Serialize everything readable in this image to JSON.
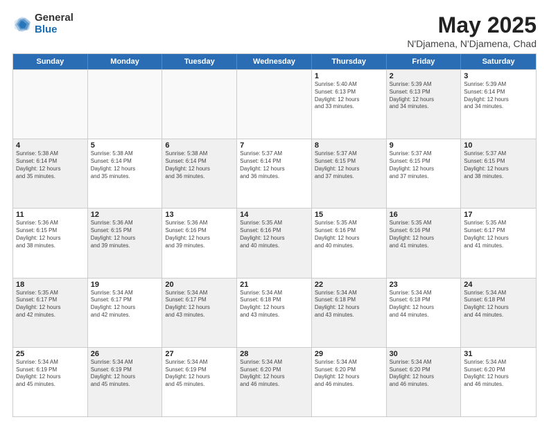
{
  "logo": {
    "general": "General",
    "blue": "Blue"
  },
  "title": "May 2025",
  "subtitle": "N'Djamena, N'Djamena, Chad",
  "header_days": [
    "Sunday",
    "Monday",
    "Tuesday",
    "Wednesday",
    "Thursday",
    "Friday",
    "Saturday"
  ],
  "rows": [
    [
      {
        "day": "",
        "detail": "",
        "empty": true
      },
      {
        "day": "",
        "detail": "",
        "empty": true
      },
      {
        "day": "",
        "detail": "",
        "empty": true
      },
      {
        "day": "",
        "detail": "",
        "empty": true
      },
      {
        "day": "1",
        "detail": "Sunrise: 5:40 AM\nSunset: 6:13 PM\nDaylight: 12 hours\nand 33 minutes.",
        "empty": false
      },
      {
        "day": "2",
        "detail": "Sunrise: 5:39 AM\nSunset: 6:13 PM\nDaylight: 12 hours\nand 34 minutes.",
        "empty": false,
        "shaded": true
      },
      {
        "day": "3",
        "detail": "Sunrise: 5:39 AM\nSunset: 6:14 PM\nDaylight: 12 hours\nand 34 minutes.",
        "empty": false
      }
    ],
    [
      {
        "day": "4",
        "detail": "Sunrise: 5:38 AM\nSunset: 6:14 PM\nDaylight: 12 hours\nand 35 minutes.",
        "empty": false,
        "shaded": true
      },
      {
        "day": "5",
        "detail": "Sunrise: 5:38 AM\nSunset: 6:14 PM\nDaylight: 12 hours\nand 35 minutes.",
        "empty": false
      },
      {
        "day": "6",
        "detail": "Sunrise: 5:38 AM\nSunset: 6:14 PM\nDaylight: 12 hours\nand 36 minutes.",
        "empty": false,
        "shaded": true
      },
      {
        "day": "7",
        "detail": "Sunrise: 5:37 AM\nSunset: 6:14 PM\nDaylight: 12 hours\nand 36 minutes.",
        "empty": false
      },
      {
        "day": "8",
        "detail": "Sunrise: 5:37 AM\nSunset: 6:15 PM\nDaylight: 12 hours\nand 37 minutes.",
        "empty": false,
        "shaded": true
      },
      {
        "day": "9",
        "detail": "Sunrise: 5:37 AM\nSunset: 6:15 PM\nDaylight: 12 hours\nand 37 minutes.",
        "empty": false
      },
      {
        "day": "10",
        "detail": "Sunrise: 5:37 AM\nSunset: 6:15 PM\nDaylight: 12 hours\nand 38 minutes.",
        "empty": false,
        "shaded": true
      }
    ],
    [
      {
        "day": "11",
        "detail": "Sunrise: 5:36 AM\nSunset: 6:15 PM\nDaylight: 12 hours\nand 38 minutes.",
        "empty": false
      },
      {
        "day": "12",
        "detail": "Sunrise: 5:36 AM\nSunset: 6:15 PM\nDaylight: 12 hours\nand 39 minutes.",
        "empty": false,
        "shaded": true
      },
      {
        "day": "13",
        "detail": "Sunrise: 5:36 AM\nSunset: 6:16 PM\nDaylight: 12 hours\nand 39 minutes.",
        "empty": false
      },
      {
        "day": "14",
        "detail": "Sunrise: 5:35 AM\nSunset: 6:16 PM\nDaylight: 12 hours\nand 40 minutes.",
        "empty": false,
        "shaded": true
      },
      {
        "day": "15",
        "detail": "Sunrise: 5:35 AM\nSunset: 6:16 PM\nDaylight: 12 hours\nand 40 minutes.",
        "empty": false
      },
      {
        "day": "16",
        "detail": "Sunrise: 5:35 AM\nSunset: 6:16 PM\nDaylight: 12 hours\nand 41 minutes.",
        "empty": false,
        "shaded": true
      },
      {
        "day": "17",
        "detail": "Sunrise: 5:35 AM\nSunset: 6:17 PM\nDaylight: 12 hours\nand 41 minutes.",
        "empty": false
      }
    ],
    [
      {
        "day": "18",
        "detail": "Sunrise: 5:35 AM\nSunset: 6:17 PM\nDaylight: 12 hours\nand 42 minutes.",
        "empty": false,
        "shaded": true
      },
      {
        "day": "19",
        "detail": "Sunrise: 5:34 AM\nSunset: 6:17 PM\nDaylight: 12 hours\nand 42 minutes.",
        "empty": false
      },
      {
        "day": "20",
        "detail": "Sunrise: 5:34 AM\nSunset: 6:17 PM\nDaylight: 12 hours\nand 43 minutes.",
        "empty": false,
        "shaded": true
      },
      {
        "day": "21",
        "detail": "Sunrise: 5:34 AM\nSunset: 6:18 PM\nDaylight: 12 hours\nand 43 minutes.",
        "empty": false
      },
      {
        "day": "22",
        "detail": "Sunrise: 5:34 AM\nSunset: 6:18 PM\nDaylight: 12 hours\nand 43 minutes.",
        "empty": false,
        "shaded": true
      },
      {
        "day": "23",
        "detail": "Sunrise: 5:34 AM\nSunset: 6:18 PM\nDaylight: 12 hours\nand 44 minutes.",
        "empty": false
      },
      {
        "day": "24",
        "detail": "Sunrise: 5:34 AM\nSunset: 6:18 PM\nDaylight: 12 hours\nand 44 minutes.",
        "empty": false,
        "shaded": true
      }
    ],
    [
      {
        "day": "25",
        "detail": "Sunrise: 5:34 AM\nSunset: 6:19 PM\nDaylight: 12 hours\nand 45 minutes.",
        "empty": false
      },
      {
        "day": "26",
        "detail": "Sunrise: 5:34 AM\nSunset: 6:19 PM\nDaylight: 12 hours\nand 45 minutes.",
        "empty": false,
        "shaded": true
      },
      {
        "day": "27",
        "detail": "Sunrise: 5:34 AM\nSunset: 6:19 PM\nDaylight: 12 hours\nand 45 minutes.",
        "empty": false
      },
      {
        "day": "28",
        "detail": "Sunrise: 5:34 AM\nSunset: 6:20 PM\nDaylight: 12 hours\nand 46 minutes.",
        "empty": false,
        "shaded": true
      },
      {
        "day": "29",
        "detail": "Sunrise: 5:34 AM\nSunset: 6:20 PM\nDaylight: 12 hours\nand 46 minutes.",
        "empty": false
      },
      {
        "day": "30",
        "detail": "Sunrise: 5:34 AM\nSunset: 6:20 PM\nDaylight: 12 hours\nand 46 minutes.",
        "empty": false,
        "shaded": true
      },
      {
        "day": "31",
        "detail": "Sunrise: 5:34 AM\nSunset: 6:20 PM\nDaylight: 12 hours\nand 46 minutes.",
        "empty": false
      }
    ]
  ]
}
